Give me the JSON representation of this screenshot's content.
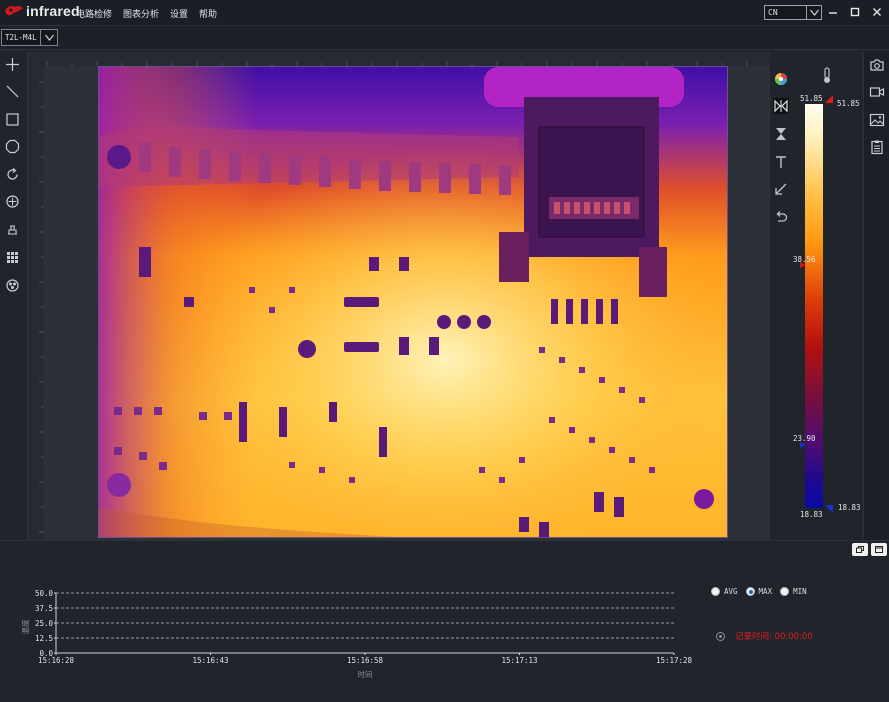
{
  "app": {
    "logo_text": "infrared",
    "menu": [
      "电路检修",
      "图表分析",
      "设置",
      "帮助"
    ],
    "language": "CN",
    "window_buttons": [
      "minimize-icon",
      "maximize-icon",
      "close-icon"
    ]
  },
  "device": {
    "selected": "T2L-M4L"
  },
  "left_tools": [
    "crosshair-icon",
    "line-icon",
    "rectangle-icon",
    "polygon-icon",
    "rotate-icon",
    "target-icon",
    "stamp-icon",
    "grid-icon",
    "filter-icon"
  ],
  "palette_tools": [
    "color-palette-icon",
    "split-icon",
    "hourglass-icon",
    "text-icon",
    "arrow-icon",
    "undo-icon"
  ],
  "colorbar": {
    "top_label": "51.85",
    "top_marker_label": "51.85",
    "mid_label": "38.56",
    "lower_label": "23.90",
    "bottom_label": "18.83",
    "bottom_marker_label": "18.83",
    "colors": {
      "top": "#fffdf0",
      "mid": "#e0400a",
      "bottom": "#0a0aa8"
    }
  },
  "right_tools": [
    "camera-icon",
    "video-icon",
    "image-icon",
    "clipboard-icon"
  ],
  "chart_data": {
    "type": "line",
    "ylabel": "温度",
    "xlabel": "时间",
    "x": [
      "15:16:28",
      "15:16:43",
      "15:16:58",
      "15:17:13",
      "15:17:28"
    ],
    "y_ticks": [
      "50.0",
      "37.5",
      "25.0",
      "12.5",
      "0.0"
    ],
    "ylim": [
      0,
      50
    ],
    "grid": true,
    "series": []
  },
  "radios": {
    "options": [
      "AVG",
      "MAX",
      "MIN"
    ],
    "selected": "MAX"
  },
  "record": {
    "label": "记录时间: 00:00:00"
  }
}
